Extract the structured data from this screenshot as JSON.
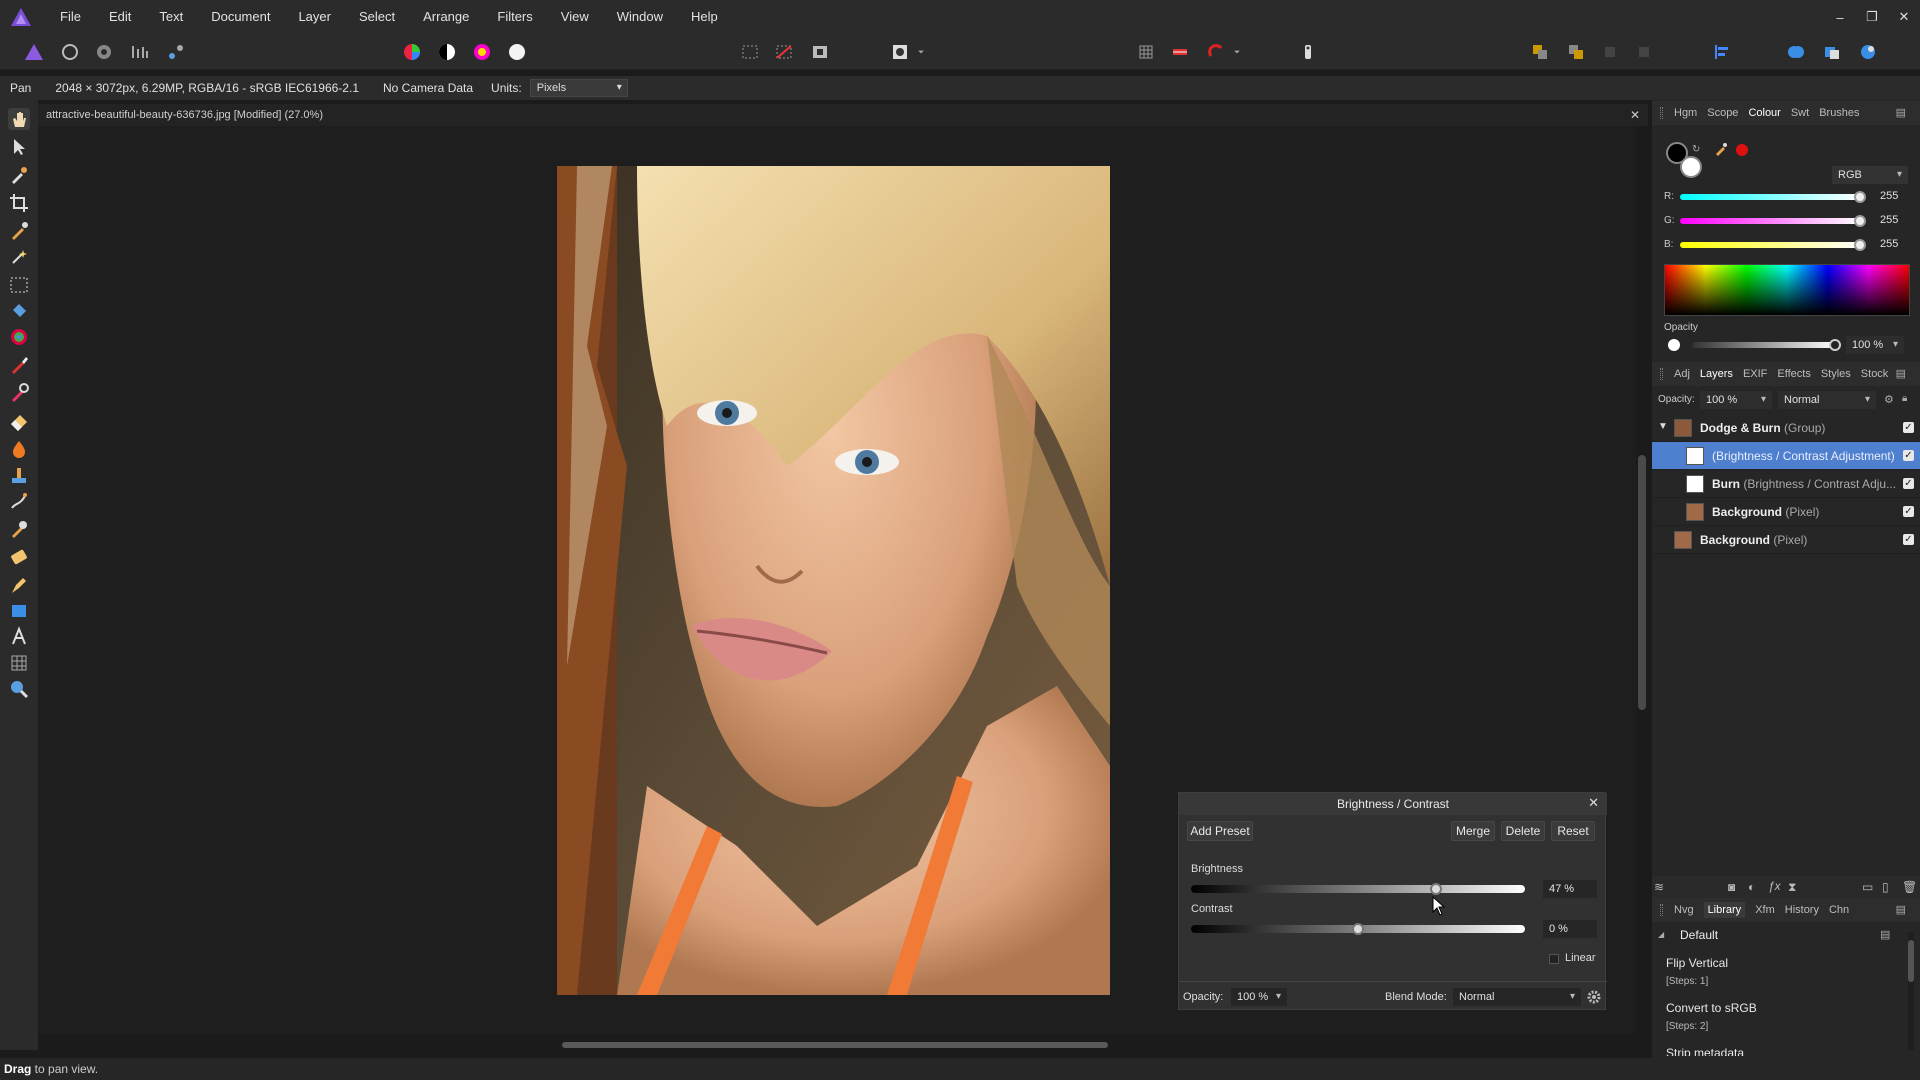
{
  "menubar": {
    "items": [
      "File",
      "Edit",
      "Text",
      "Document",
      "Layer",
      "Select",
      "Arrange",
      "Filters",
      "View",
      "Window",
      "Help"
    ],
    "controls": [
      "–",
      "❐",
      "✕"
    ]
  },
  "context": {
    "tool": "Pan",
    "info": "2048 × 3072px, 6.29MP, RGBA/16 - sRGB IEC61966-2.1",
    "camera": "No Camera Data",
    "units_label": "Units:",
    "units_value": "Pixels"
  },
  "document": {
    "tab_title": "attractive-beautiful-beauty-636736.jpg [Modified] (27.0%)"
  },
  "status": {
    "bold": "Drag",
    "text": " to pan view."
  },
  "colour_panel": {
    "tabs": [
      "Hgm",
      "Scope",
      "Colour",
      "Swt",
      "Brushes"
    ],
    "active_tab": "Colour",
    "mode": "RGB",
    "channels": [
      {
        "label": "R:",
        "value": "255"
      },
      {
        "label": "G:",
        "value": "255"
      },
      {
        "label": "B:",
        "value": "255"
      }
    ],
    "opacity_label": "Opacity",
    "opacity_value": "100 %"
  },
  "layers_panel": {
    "tabs": [
      "Adj",
      "Layers",
      "EXIF",
      "Effects",
      "Styles",
      "Stock"
    ],
    "active_tab": "Layers",
    "opacity_label": "Opacity:",
    "opacity_value": "100 %",
    "blend": "Normal",
    "layers": [
      {
        "name": "Dodge & Burn",
        "type": "(Group)"
      },
      {
        "name": "",
        "type": "(Brightness / Contrast Adjustment)"
      },
      {
        "name": "Burn",
        "type": "(Brightness / Contrast Adju..."
      },
      {
        "name": "Background",
        "type": "(Pixel)"
      },
      {
        "name": "Background",
        "type": "(Pixel)"
      }
    ]
  },
  "history_panel": {
    "tabs": [
      "Nvg",
      "Library",
      "Xfm",
      "History",
      "Chn"
    ],
    "active_tab": "Library",
    "group": "Default",
    "items": [
      {
        "name": "Flip Vertical",
        "steps": "[Steps: 1]"
      },
      {
        "name": "Convert to sRGB",
        "steps": "[Steps: 2]"
      },
      {
        "name": "Strip metadata",
        "steps": ""
      }
    ]
  },
  "bc_dialog": {
    "title": "Brightness / Contrast",
    "add_preset": "Add Preset",
    "merge": "Merge",
    "delete": "Delete",
    "reset": "Reset",
    "brightness_label": "Brightness",
    "brightness_value": "47 %",
    "brightness_level": 0.735,
    "contrast_label": "Contrast",
    "contrast_value": "0 %",
    "contrast_level": 0.5,
    "linear_label": "Linear",
    "opacity_label": "Opacity:",
    "opacity_value": "100 %",
    "blend_label": "Blend Mode:",
    "blend_value": "Normal"
  },
  "colors": {
    "accent": "#4a78c8",
    "selected_row": "#4f7fcf",
    "primary_colour": "#000000",
    "secondary_colour": "#ffffff"
  }
}
